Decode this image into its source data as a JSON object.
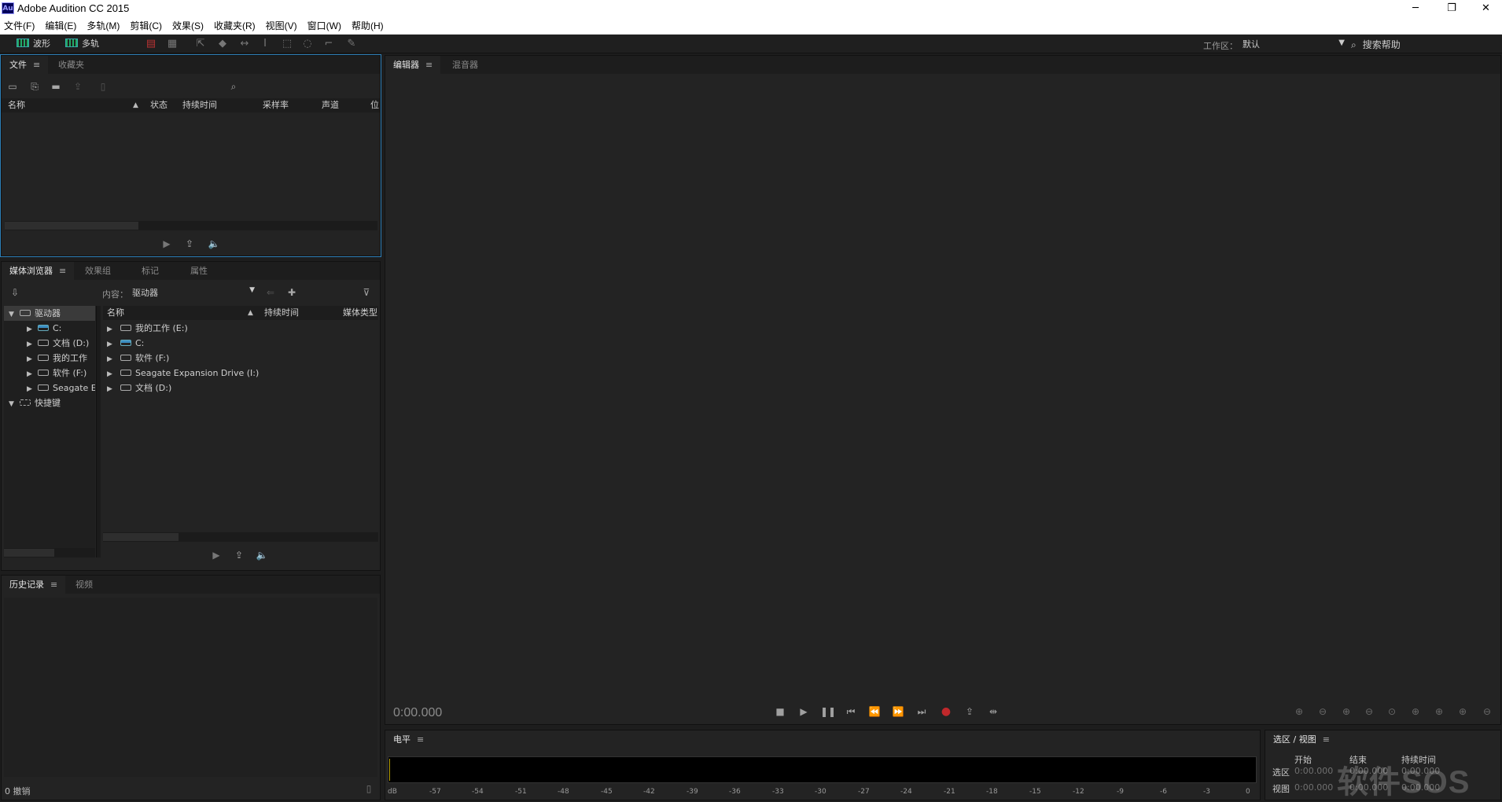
{
  "window": {
    "title": "Adobe Audition CC 2015",
    "logo_text": "Au",
    "minimize": "─",
    "restore": "❐",
    "close": "✕"
  },
  "menu": [
    "文件(F)",
    "编辑(E)",
    "多轨(M)",
    "剪辑(C)",
    "效果(S)",
    "收藏夹(R)",
    "视图(V)",
    "窗口(W)",
    "帮助(H)"
  ],
  "toolbar": {
    "waveform_label": "波形",
    "multitrack_label": "多轨",
    "workspace_label": "工作区：",
    "workspace_value": "默认",
    "help_search": "搜索帮助"
  },
  "files_panel": {
    "tabs": [
      "文件",
      "收藏夹"
    ],
    "columns": [
      "名称",
      "状态",
      "持续时间",
      "采样率",
      "声道",
      "位"
    ]
  },
  "media_panel": {
    "tabs": [
      "媒体浏览器",
      "效果组",
      "标记",
      "属性"
    ],
    "content_label": "内容：",
    "content_value": "驱动器",
    "tree": [
      {
        "label": "驱动器",
        "level": 0,
        "expanded": true
      },
      {
        "label": "C:",
        "level": 1,
        "system": true
      },
      {
        "label": "文档 (D:)",
        "level": 1
      },
      {
        "label": "我的工作",
        "level": 1
      },
      {
        "label": "软件 (F:)",
        "level": 1
      },
      {
        "label": "Seagate E",
        "level": 1
      },
      {
        "label": "快捷键",
        "level": 0,
        "expanded": true
      }
    ],
    "columns": [
      "名称",
      "持续时间",
      "媒体类型"
    ],
    "items": [
      {
        "label": "我的工作 (E:)",
        "system": false
      },
      {
        "label": "C:",
        "system": true
      },
      {
        "label": "软件 (F:)",
        "system": false
      },
      {
        "label": "Seagate Expansion Drive (I:)",
        "system": false
      },
      {
        "label": "文档 (D:)",
        "system": false
      }
    ]
  },
  "history_panel": {
    "tabs": [
      "历史记录",
      "视频"
    ],
    "status": "0 撤销"
  },
  "editor_panel": {
    "tabs": [
      "编辑器",
      "混音器"
    ],
    "time": "0:00.000"
  },
  "level_panel": {
    "tab": "电平",
    "ticks": [
      "dB",
      "-57",
      "-54",
      "-51",
      "-48",
      "-45",
      "-42",
      "-39",
      "-36",
      "-33",
      "-30",
      "-27",
      "-24",
      "-21",
      "-18",
      "-15",
      "-12",
      "-9",
      "-6",
      "-3",
      "0"
    ]
  },
  "selection_panel": {
    "tab": "选区 / 视图",
    "col_start": "开始",
    "col_end": "结束",
    "col_duration": "持续时间",
    "row_selection": "选区",
    "row_view": "视图",
    "sel_start": "0:00.000",
    "sel_end": "0:00.000",
    "sel_dur": "0:00.000",
    "view_start": "0:00.000",
    "view_end": "0:00.000",
    "view_dur": "0:00.000"
  },
  "watermark": "软件SOS",
  "colors": {
    "accent_focus": "#2d7fb8",
    "record": "#c0282b",
    "panel_bg": "#232323",
    "app_bg": "#1d1d1d"
  }
}
